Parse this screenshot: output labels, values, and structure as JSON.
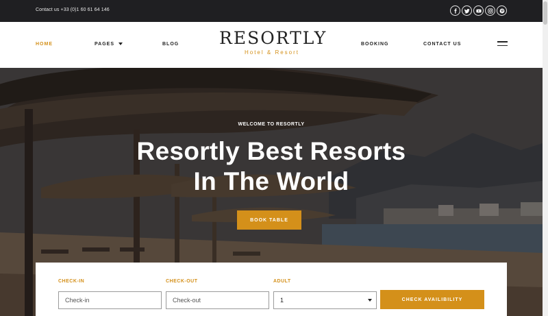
{
  "topbar": {
    "contact": "Contact us +33 (0)1 60 61 64 146",
    "social": [
      "facebook-icon",
      "twitter-icon",
      "youtube-icon",
      "instagram-icon",
      "pinterest-icon"
    ]
  },
  "nav": {
    "home": "HOME",
    "pages": "PAGES",
    "blog": "BLOG",
    "booking": "BOOKING",
    "contact": "CONTACT US"
  },
  "logo": {
    "title": "RESORTLY",
    "subtitle": "Hotel & Resort"
  },
  "hero": {
    "eyebrow": "WELCOME TO RESORTLY",
    "headline_line1": "Resortly Best Resorts",
    "headline_line2": "In The World",
    "button": "BOOK TABLE"
  },
  "booking": {
    "checkin_label": "CHECK-IN",
    "checkin_placeholder": "Check-in",
    "checkout_label": "CHECK-OUT",
    "checkout_placeholder": "Check-out",
    "adult_label": "ADULT",
    "adult_value": "1",
    "submit": "CHECK AVAILIBILITY"
  },
  "colors": {
    "accent": "#d4901a",
    "topbar": "#1f1f22"
  }
}
